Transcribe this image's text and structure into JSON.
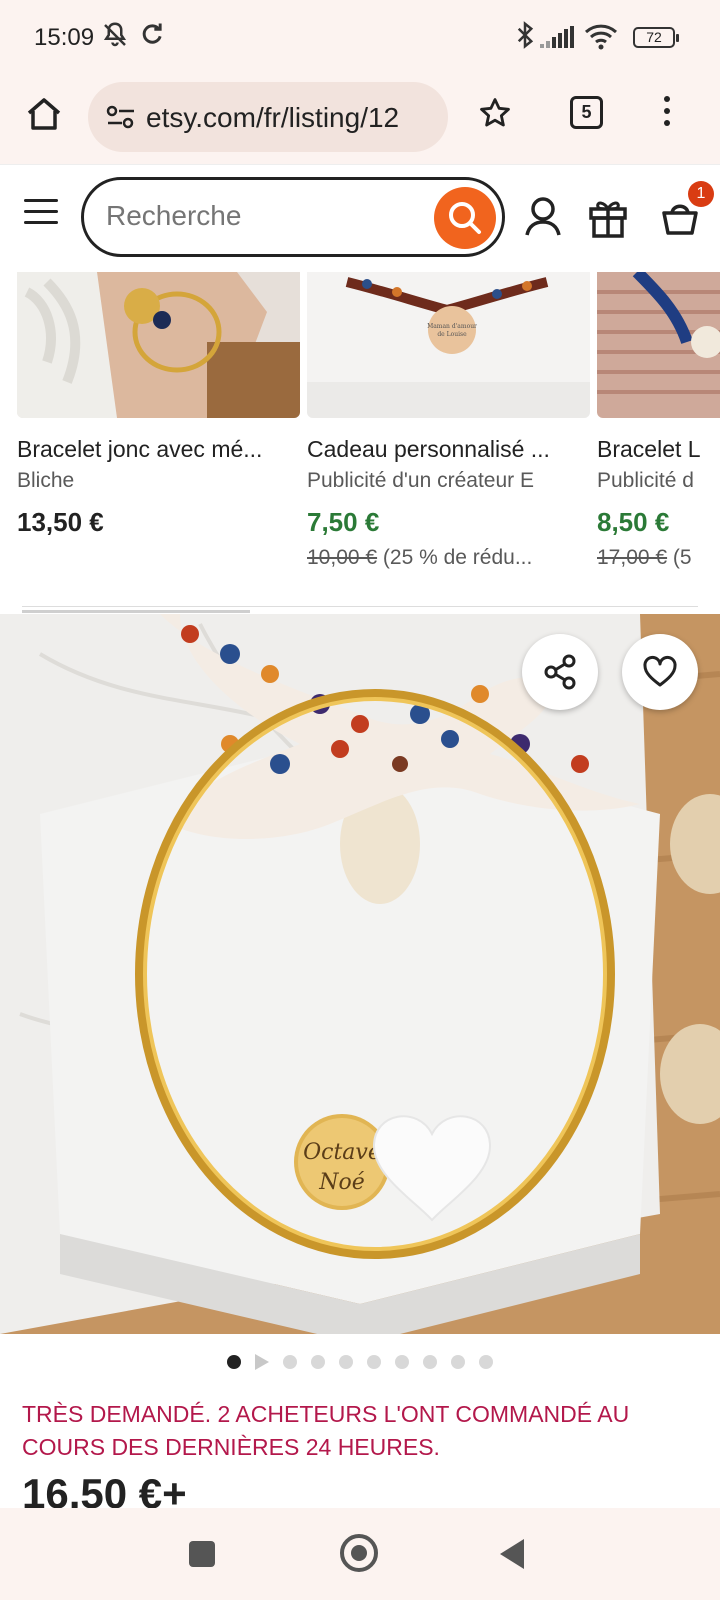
{
  "status_bar": {
    "time": "15:09",
    "battery": "72"
  },
  "browser": {
    "url": "etsy.com/fr/listing/12",
    "tab_count": "5"
  },
  "header": {
    "search_placeholder": "Recherche",
    "cart_count": "1"
  },
  "recommendations": [
    {
      "title": "Bracelet jonc avec mé...",
      "shop": "Bliche",
      "price": "13,50 €",
      "original_price": "",
      "discount": ""
    },
    {
      "title": "Cadeau personnalisé ...",
      "shop": "Publicité d'un créateur E",
      "price": "7,50 €",
      "original_price": "10,00 €",
      "discount": " (25 % de rédu..."
    },
    {
      "title": "Bracelet L",
      "shop": "Publicité d",
      "price": "8,50 €",
      "original_price": "17,00 €",
      "discount": " (5"
    }
  ],
  "listing": {
    "image_carousel": {
      "total_images": 10,
      "active_index": 0
    },
    "demand_badge": "TRÈS DEMANDÉ. 2 ACHETEURS L'ONT COMMANDÉ AU COURS DES DERNIÈRES 24 HEURES.",
    "price": "16,50 €+",
    "charm_text_line1": "Octave",
    "charm_text_line2": "Noé"
  },
  "colors": {
    "etsy_orange": "#f1641e",
    "sale_green": "#2b7a37",
    "demand_pink": "#b3184b",
    "browser_bg": "#fcf3f0"
  }
}
